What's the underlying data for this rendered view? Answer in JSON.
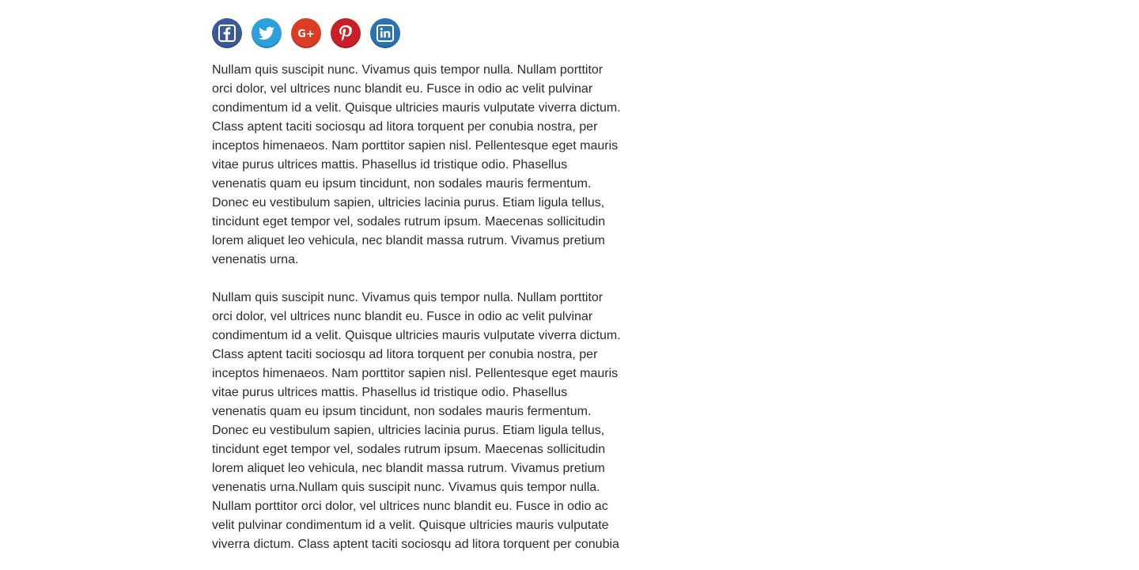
{
  "share": {
    "buttons": [
      {
        "name": "facebook",
        "icon": "facebook-icon",
        "color": "#3b5998"
      },
      {
        "name": "twitter",
        "icon": "twitter-icon",
        "color": "#2ba0dc"
      },
      {
        "name": "google-plus",
        "icon": "google-plus-icon",
        "color": "#dd3b26"
      },
      {
        "name": "pinterest",
        "icon": "pinterest-icon",
        "color": "#cb1f27"
      },
      {
        "name": "linkedin",
        "icon": "linkedin-icon",
        "color": "#2b72b0"
      }
    ],
    "google_plus_label": "G+"
  },
  "article": {
    "paragraphs": [
      "Nullam quis suscipit nunc. Vivamus quis tempor nulla. Nullam porttitor orci dolor, vel ultrices nunc blandit eu. Fusce in odio ac velit pulvinar condimentum id a velit. Quisque ultricies mauris vulputate viverra dictum. Class aptent taciti sociosqu ad litora torquent per conubia nostra, per inceptos himenaeos. Nam porttitor sapien nisl. Pellentesque eget mauris vitae purus ultrices mattis. Phasellus id tristique odio. Phasellus venenatis quam eu ipsum tincidunt, non sodales mauris fermentum. Donec eu vestibulum sapien, ultricies lacinia purus. Etiam ligula tellus, tincidunt eget tempor vel, sodales rutrum ipsum. Maecenas sollicitudin lorem aliquet leo vehicula, nec blandit massa rutrum. Vivamus pretium venenatis urna.",
      "Nullam quis suscipit nunc. Vivamus quis tempor nulla. Nullam porttitor orci dolor, vel ultrices nunc blandit eu. Fusce in odio ac velit pulvinar condimentum id a velit. Quisque ultricies mauris vulputate viverra dictum. Class aptent taciti sociosqu ad litora torquent per conubia nostra, per inceptos himenaeos. Nam porttitor sapien nisl. Pellentesque eget mauris vitae purus ultrices mattis. Phasellus id tristique odio. Phasellus venenatis quam eu ipsum tincidunt, non sodales mauris fermentum. Donec eu vestibulum sapien, ultricies lacinia purus. Etiam ligula tellus, tincidunt eget tempor vel, sodales rutrum ipsum. Maecenas sollicitudin lorem aliquet leo vehicula, nec blandit massa rutrum. Vivamus pretium venenatis urna.Nullam quis suscipit nunc. Vivamus quis tempor nulla. Nullam porttitor orci dolor, vel ultrices nunc blandit eu. Fusce in odio ac velit pulvinar condimentum id a velit. Quisque ultricies mauris vulputate viverra dictum. Class aptent taciti sociosqu ad litora torquent per conubia"
    ]
  }
}
